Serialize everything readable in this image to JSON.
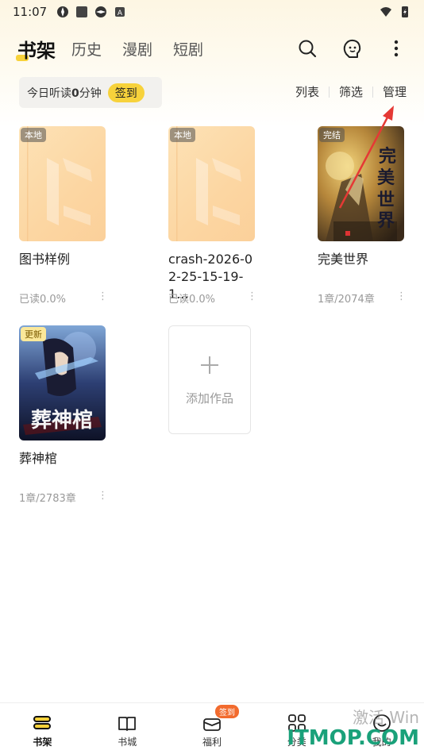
{
  "status_bar": {
    "time": "11:07"
  },
  "top_nav": {
    "tabs": [
      {
        "label": "书架",
        "active": true
      },
      {
        "label": "历史"
      },
      {
        "label": "漫剧"
      },
      {
        "label": "短剧"
      }
    ],
    "icons": [
      "search-icon",
      "listen-face-icon",
      "more-vertical-icon"
    ]
  },
  "reading": {
    "today_prefix": "今日听读",
    "minutes": "0",
    "suffix": "分钟",
    "signin_label": "签到"
  },
  "actions": {
    "list": "列表",
    "filter": "筛选",
    "manage": "管理"
  },
  "books": [
    {
      "title": "图书样例",
      "meta": "已读0.0%",
      "tag": "本地",
      "cover": "local"
    },
    {
      "title": "crash-2026-02-25-15-19-1...",
      "meta": "已读0.0%",
      "tag": "本地",
      "cover": "local"
    },
    {
      "title": "完美世界",
      "meta": "1章/2074章",
      "tag": "完结",
      "cover": "perfect-world-cover"
    },
    {
      "title": "葬神棺",
      "meta": "1章/2783章",
      "tag": "更新",
      "cover": "zangshenguan-cover"
    }
  ],
  "add_card": {
    "label": "添加作品"
  },
  "bottom_nav": {
    "items": [
      {
        "label": "书架",
        "active": true
      },
      {
        "label": "书城"
      },
      {
        "label": "福利",
        "badge": "签到"
      },
      {
        "label": "分类"
      },
      {
        "label": "我的"
      }
    ]
  },
  "watermark": {
    "line1": "激活 Win",
    "line2": "ITMOP.COM"
  },
  "colors": {
    "accent": "#f7d23b",
    "badge": "#f26b2e",
    "arrow": "#e53935"
  }
}
